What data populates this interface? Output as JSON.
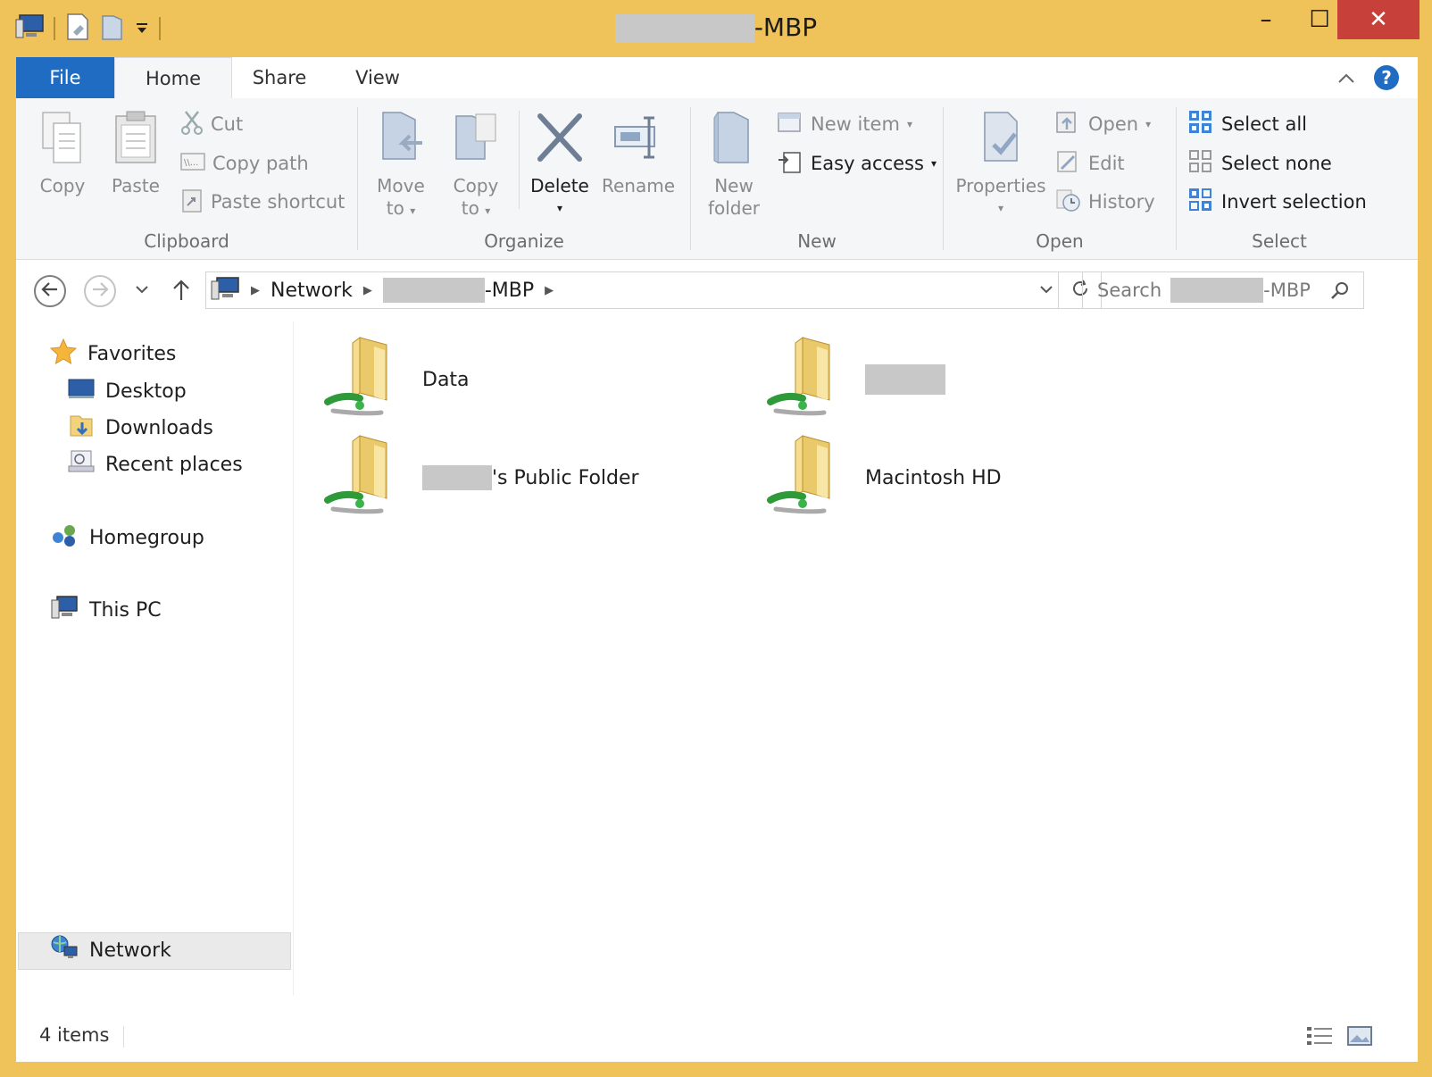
{
  "window": {
    "title_suffix": "-MBP",
    "controls": {
      "minimize": "–",
      "maximize": "☐",
      "close": "✕"
    }
  },
  "tabs": [
    {
      "label": "File"
    },
    {
      "label": "Home"
    },
    {
      "label": "Share"
    },
    {
      "label": "View"
    }
  ],
  "ribbon": {
    "clipboard": {
      "label": "Clipboard",
      "copy": "Copy",
      "paste": "Paste",
      "cut": "Cut",
      "copy_path": "Copy path",
      "paste_shortcut": "Paste shortcut"
    },
    "organize": {
      "label": "Organize",
      "move_to": [
        "Move",
        "to"
      ],
      "copy_to": [
        "Copy",
        "to"
      ],
      "delete": "Delete",
      "rename": "Rename"
    },
    "new": {
      "label": "New",
      "new_folder": [
        "New",
        "folder"
      ],
      "new_item": "New item",
      "easy_access": "Easy access"
    },
    "open": {
      "label": "Open",
      "properties": "Properties",
      "open": "Open",
      "edit": "Edit",
      "history": "History"
    },
    "select": {
      "label": "Select",
      "select_all": "Select all",
      "select_none": "Select none",
      "invert_selection": "Invert selection"
    }
  },
  "address": {
    "crumbs": [
      "Network",
      "-MBP"
    ]
  },
  "search": {
    "prefix": "Search",
    "suffix": "-MBP"
  },
  "nav": {
    "favorites": "Favorites",
    "desktop": "Desktop",
    "downloads": "Downloads",
    "recent": "Recent places",
    "homegroup": "Homegroup",
    "this_pc": "This PC",
    "network": "Network"
  },
  "items": [
    {
      "label": "Data"
    },
    {
      "label": ""
    },
    {
      "label": "'s Public Folder"
    },
    {
      "label": "Macintosh HD"
    }
  ],
  "status": {
    "count": "4 items"
  },
  "colors": {
    "frame": "#f0c25a",
    "file_tab": "#1f6cc2",
    "close_button": "#c7413a",
    "redaction": "#c8c8c8"
  }
}
